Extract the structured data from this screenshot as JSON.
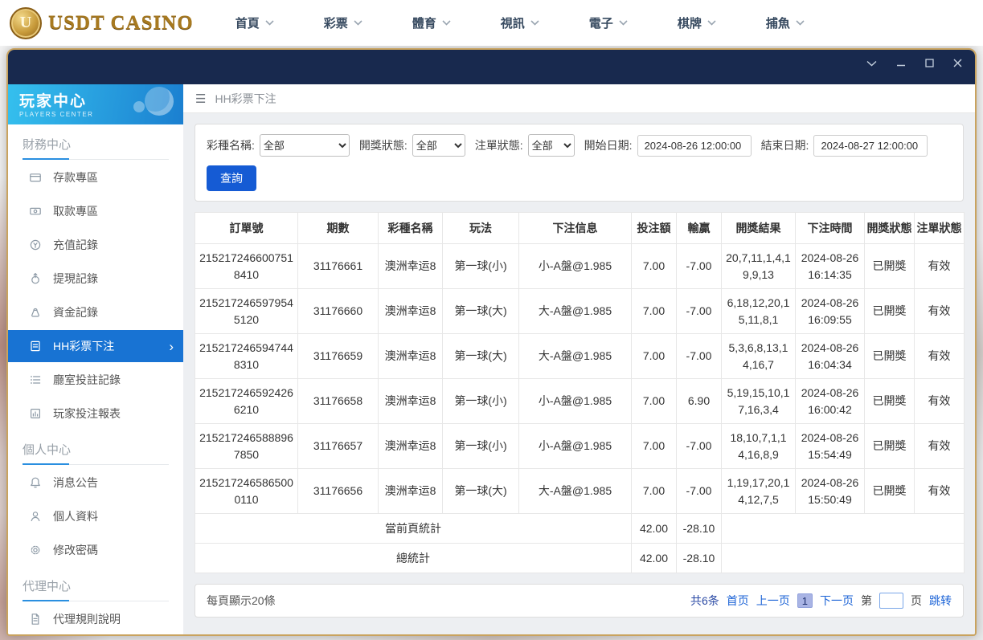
{
  "topnav": {
    "logo_letter": "U",
    "logo_text": "USDT CASINO",
    "items": [
      {
        "label": "首頁"
      },
      {
        "label": "彩票"
      },
      {
        "label": "體育"
      },
      {
        "label": "視訊"
      },
      {
        "label": "電子"
      },
      {
        "label": "棋牌"
      },
      {
        "label": "捕魚"
      }
    ]
  },
  "sidebar": {
    "title": "玩家中心",
    "subtitle": "PLAYERS CENTER",
    "sections": [
      {
        "title": "財務中心",
        "items": [
          {
            "label": "存款專區",
            "icon": "card-icon"
          },
          {
            "label": "取款專區",
            "icon": "banknote-icon"
          },
          {
            "label": "充值記錄",
            "icon": "recharge-icon"
          },
          {
            "label": "提現記錄",
            "icon": "withdraw-icon"
          },
          {
            "label": "資金記錄",
            "icon": "moneybag-icon"
          },
          {
            "label": "HH彩票下注",
            "icon": "ticket-icon",
            "active": true
          },
          {
            "label": "廳室投註記錄",
            "icon": "list-icon"
          },
          {
            "label": "玩家投注報表",
            "icon": "report-icon"
          }
        ]
      },
      {
        "title": "個人中心",
        "items": [
          {
            "label": "消息公告",
            "icon": "bell-icon"
          },
          {
            "label": "個人資料",
            "icon": "user-icon"
          },
          {
            "label": "修改密碼",
            "icon": "gear-icon"
          }
        ]
      },
      {
        "title": "代理中心",
        "items": [
          {
            "label": "代理規則說明",
            "icon": "doc-icon"
          }
        ]
      }
    ]
  },
  "main": {
    "breadcrumb": "HH彩票下注",
    "filters": {
      "groups": [
        {
          "label": "彩種名稱:",
          "type": "select",
          "value": "全部",
          "name": "lottery-select",
          "w": "wide"
        },
        {
          "label": "開獎狀態:",
          "type": "select",
          "value": "全部",
          "name": "draw-status-select",
          "w": "mid"
        },
        {
          "label": "注單狀態:",
          "type": "select",
          "value": "全部",
          "name": "order-status-select",
          "w": "sm"
        },
        {
          "label": "開始日期:",
          "type": "input",
          "value": "2024-08-26 12:00:00",
          "name": "start-date-input"
        },
        {
          "label": "結束日期:",
          "type": "input",
          "value": "2024-08-27 12:00:00",
          "name": "end-date-input"
        }
      ],
      "search_button": "查詢"
    },
    "table": {
      "headers": [
        "訂單號",
        "期數",
        "彩種名稱",
        "玩法",
        "下注信息",
        "投注額",
        "輸贏",
        "開獎結果",
        "下注時間",
        "開獎狀態",
        "注單狀態"
      ],
      "rows": [
        [
          "2152172466007518410",
          "31176661",
          "澳洲幸运8",
          "第一球(小)",
          "小-A盤@1.985",
          "7.00",
          "-7.00",
          "20,7,11,1,4,19,9,13",
          "2024-08-26 16:14:35",
          "已開獎",
          "有效"
        ],
        [
          "2152172465979545120",
          "31176660",
          "澳洲幸运8",
          "第一球(大)",
          "大-A盤@1.985",
          "7.00",
          "-7.00",
          "6,18,12,20,15,11,8,1",
          "2024-08-26 16:09:55",
          "已開獎",
          "有效"
        ],
        [
          "2152172465947448310",
          "31176659",
          "澳洲幸运8",
          "第一球(大)",
          "大-A盤@1.985",
          "7.00",
          "-7.00",
          "5,3,6,8,13,14,16,7",
          "2024-08-26 16:04:34",
          "已開獎",
          "有效"
        ],
        [
          "2152172465924266210",
          "31176658",
          "澳洲幸运8",
          "第一球(小)",
          "小-A盤@1.985",
          "7.00",
          "6.90",
          "5,19,15,10,17,16,3,4",
          "2024-08-26 16:00:42",
          "已開獎",
          "有效"
        ],
        [
          "2152172465888967850",
          "31176657",
          "澳洲幸运8",
          "第一球(小)",
          "小-A盤@1.985",
          "7.00",
          "-7.00",
          "18,10,7,1,14,16,8,9",
          "2024-08-26 15:54:49",
          "已開獎",
          "有效"
        ],
        [
          "2152172465865000110",
          "31176656",
          "澳洲幸运8",
          "第一球(大)",
          "大-A盤@1.985",
          "7.00",
          "-7.00",
          "1,19,17,20,14,12,7,5",
          "2024-08-26 15:50:49",
          "已開獎",
          "有效"
        ]
      ],
      "summary_rows": [
        {
          "label": "當前頁統計",
          "bet": "42.00",
          "winloss": "-28.10"
        },
        {
          "label": "總統計",
          "bet": "42.00",
          "winloss": "-28.10"
        }
      ]
    },
    "pagination": {
      "page_size_text": "每頁顯示20條",
      "total_text": "共6条",
      "first": "首页",
      "prev": "上一页",
      "current_page": "1",
      "next": "下一页",
      "page_prefix": "第",
      "page_suffix": "页",
      "jump": "跳转"
    }
  },
  "colors": {
    "brand_gold": "#a87a20",
    "window_border_gold": "#c9a35f",
    "titlebar_navy": "#18294e",
    "sidebar_gradient_start": "#35c0ee",
    "sidebar_gradient_end": "#1b7fd0",
    "active_item_blue": "#1873d3",
    "button_blue": "#155bd4",
    "link_blue": "#1a62d6",
    "current_page_bg": "#a9b4e4"
  }
}
